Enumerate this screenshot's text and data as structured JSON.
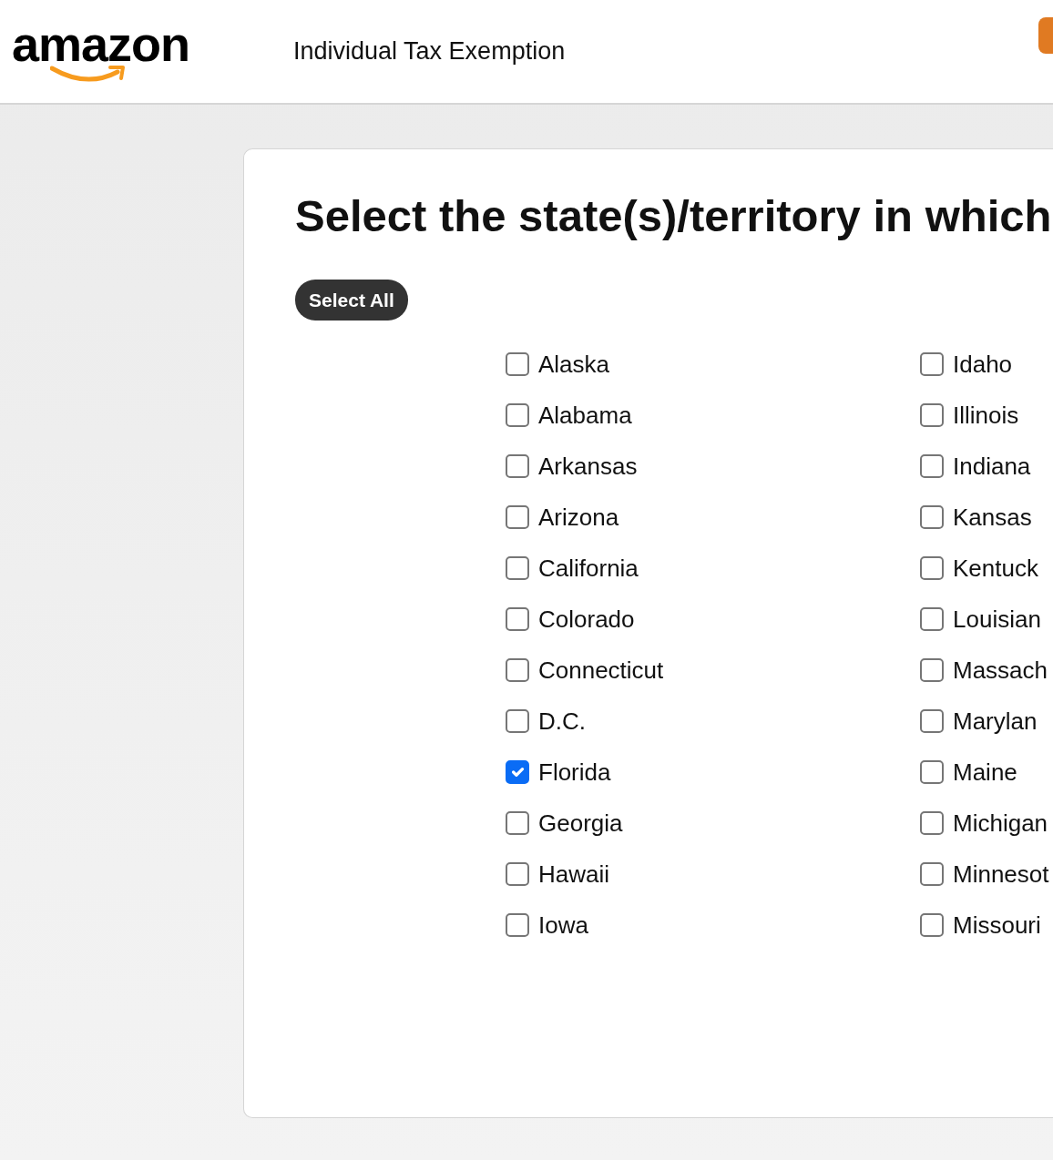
{
  "header": {
    "logo": "amazon",
    "title": "Individual Tax Exemption"
  },
  "main": {
    "heading": "Select the state(s)/territory in which",
    "select_all": "Select All",
    "columns": [
      {
        "states": [
          {
            "label": "Alaska",
            "checked": false
          },
          {
            "label": "Alabama",
            "checked": false
          },
          {
            "label": "Arkansas",
            "checked": false
          },
          {
            "label": "Arizona",
            "checked": false
          },
          {
            "label": "California",
            "checked": false
          },
          {
            "label": "Colorado",
            "checked": false
          },
          {
            "label": "Connecticut",
            "checked": false
          },
          {
            "label": "D.C.",
            "checked": false
          },
          {
            "label": "Florida",
            "checked": true
          },
          {
            "label": "Georgia",
            "checked": false
          },
          {
            "label": "Hawaii",
            "checked": false
          },
          {
            "label": "Iowa",
            "checked": false
          }
        ]
      },
      {
        "states": [
          {
            "label": "Idaho",
            "checked": false
          },
          {
            "label": "Illinois",
            "checked": false
          },
          {
            "label": "Indiana",
            "checked": false
          },
          {
            "label": "Kansas",
            "checked": false
          },
          {
            "label": "Kentuck",
            "checked": false
          },
          {
            "label": "Louisian",
            "checked": false
          },
          {
            "label": "Massach",
            "checked": false
          },
          {
            "label": "Marylan",
            "checked": false
          },
          {
            "label": "Maine",
            "checked": false
          },
          {
            "label": "Michigan",
            "checked": false
          },
          {
            "label": "Minnesot",
            "checked": false
          },
          {
            "label": "Missouri",
            "checked": false
          }
        ]
      }
    ]
  }
}
